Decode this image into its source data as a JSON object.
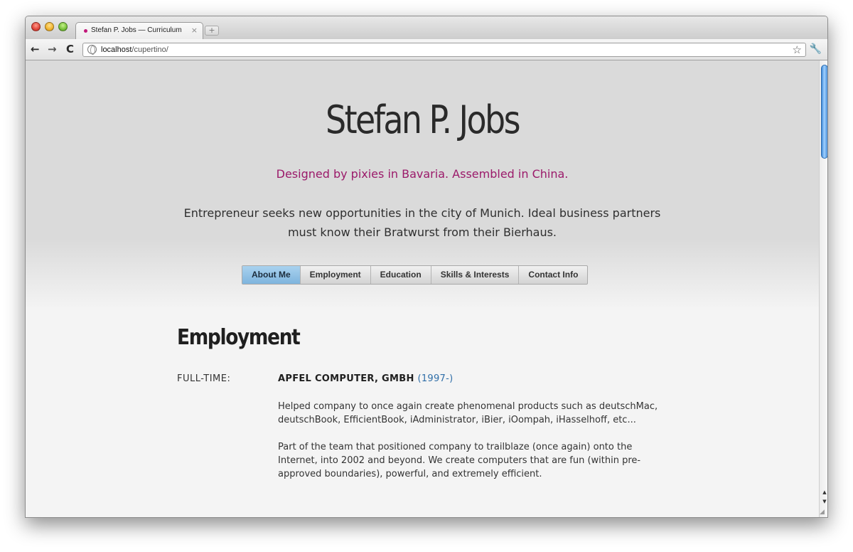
{
  "browser": {
    "tab_title": "Stefan P. Jobs — Curriculum",
    "tab_close": "×",
    "new_tab": "+",
    "url_host": "localhost",
    "url_path": "/cupertino/",
    "back": "←",
    "forward": "→",
    "reload": "C",
    "bookmark_star": "☆",
    "wrench": "🔧"
  },
  "page": {
    "name": "Stefan P. Jobs",
    "tagline": "Designed by pixies in Bavaria. Assembled in China.",
    "intro": "Entrepreneur seeks new opportunities in the city of Munich. Ideal business partners must know their Bratwurst from their Bierhaus.",
    "nav": [
      {
        "label": "About Me",
        "active": true
      },
      {
        "label": "Employment",
        "active": false
      },
      {
        "label": "Education",
        "active": false
      },
      {
        "label": "Skills & Interests",
        "active": false
      },
      {
        "label": "Contact Info",
        "active": false
      }
    ],
    "section_title": "Employment",
    "job": {
      "type": "FULL-TIME:",
      "company": "APFEL COMPUTER, GMBH",
      "years": "(1997-)",
      "paragraphs": [
        "Helped company to once again create phenomenal products such as deutschMac, deutschBook, EfficientBook, iAdministrator, iBier, iOompah, iHasselhoff, etc...",
        "Part of the team that positioned company to trailblaze (once again) onto the Internet, into 2002 and beyond. We create computers that are fun (within pre-approved boundaries), powerful, and extremely efficient."
      ]
    }
  },
  "colors": {
    "tagline": "#9b1a6a",
    "years": "#2f6ea8",
    "active_nav": "#8fc2e6"
  }
}
